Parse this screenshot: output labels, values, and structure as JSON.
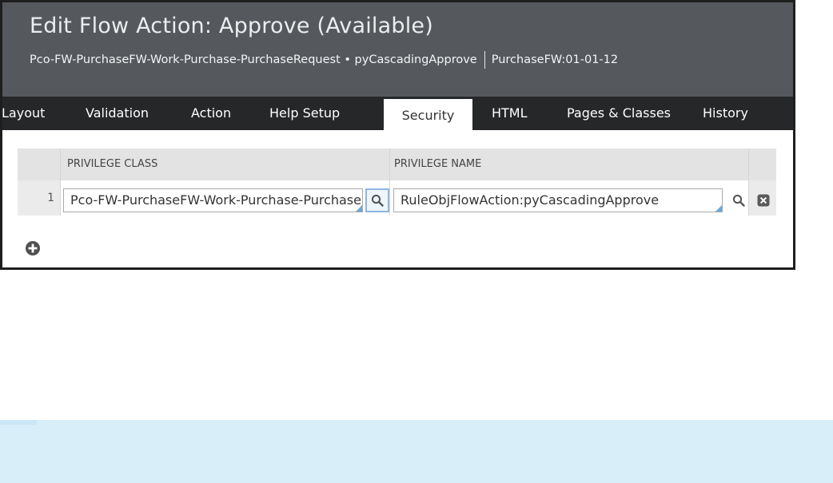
{
  "header": {
    "title": "Edit Flow Action: Approve (Available)",
    "class_name": "Pco-FW-PurchaseFW-Work-Purchase-PurchaseRequest",
    "bullet": "•",
    "rule_name": "pyCascadingApprove",
    "ruleset_version": "PurchaseFW:01-01-12"
  },
  "tabs": [
    {
      "label": "Layout",
      "active": false
    },
    {
      "label": "Validation",
      "active": false
    },
    {
      "label": "Action",
      "active": false
    },
    {
      "label": "Help Setup",
      "active": false
    },
    {
      "label": "Security",
      "active": true
    },
    {
      "label": "HTML",
      "active": false
    },
    {
      "label": "Pages & Classes",
      "active": false
    },
    {
      "label": "History",
      "active": false
    }
  ],
  "privileges": {
    "columns": [
      "PRIVILEGE CLASS",
      "PRIVILEGE NAME"
    ],
    "rows": [
      {
        "index": "1",
        "privilege_class": "Pco-FW-PurchaseFW-Work-Purchase-PurchaseRequest",
        "privilege_name": "RuleObjFlowAction:pyCascadingApprove"
      }
    ]
  },
  "icons": {
    "class_lookup": "search-icon",
    "name_lookup": "search-icon",
    "delete_row": "delete-row-icon",
    "add_row": "add-circle-icon"
  },
  "colors": {
    "header_bg": "#55595e",
    "tab_bar_bg": "#262729",
    "footer_panel_bg": "#d8effa",
    "lookup_accent": "#6ea5d8"
  }
}
